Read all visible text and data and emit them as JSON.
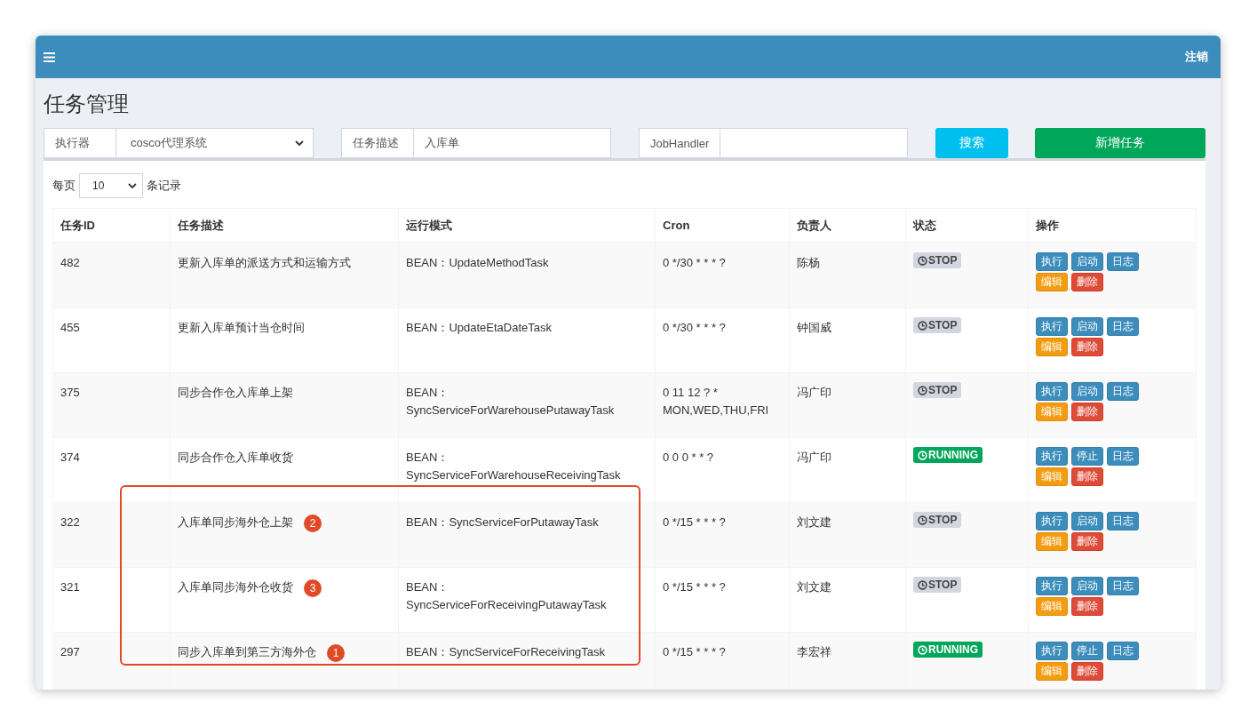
{
  "header": {
    "logout": "注销"
  },
  "page_title": "任务管理",
  "filters": {
    "executor": {
      "label": "执行器",
      "value": "cosco代理系统"
    },
    "description": {
      "label": "任务描述",
      "value": "入库单"
    },
    "handler": {
      "label": "JobHandler"
    },
    "search_button": "搜索",
    "add_button": "新增任务"
  },
  "page_size": {
    "prefix": "每页",
    "value": "10",
    "suffix": "条记录"
  },
  "table": {
    "columns": [
      "任务ID",
      "任务描述",
      "运行模式",
      "Cron",
      "负责人",
      "状态",
      "操作"
    ],
    "rows": [
      {
        "id": "482",
        "description": "更新入库单的派送方式和运输方式",
        "mode": "BEAN：UpdateMethodTask",
        "cron": "0 */30 * * * ?",
        "owner": "陈杨",
        "status": {
          "kind": "stop",
          "label": "STOP"
        },
        "actions": [
          {
            "label": "执行",
            "kind": "primary"
          },
          {
            "label": "启动",
            "kind": "primary"
          },
          {
            "label": "日志",
            "kind": "primary"
          },
          {
            "label": "编辑",
            "kind": "warning"
          },
          {
            "label": "删除",
            "kind": "danger"
          }
        ]
      },
      {
        "id": "455",
        "description": "更新入库单预计当仓时间",
        "mode": "BEAN：UpdateEtaDateTask",
        "cron": "0 */30 * * * ?",
        "owner": "钟国威",
        "status": {
          "kind": "stop",
          "label": "STOP"
        },
        "actions": [
          {
            "label": "执行",
            "kind": "primary"
          },
          {
            "label": "启动",
            "kind": "primary"
          },
          {
            "label": "日志",
            "kind": "primary"
          },
          {
            "label": "编辑",
            "kind": "warning"
          },
          {
            "label": "删除",
            "kind": "danger"
          }
        ]
      },
      {
        "id": "375",
        "description": "同步合作仓入库单上架",
        "mode": "BEAN：SyncServiceForWarehousePutawayTask",
        "cron": "0 11 12 ? * MON,WED,THU,FRI",
        "owner": "冯广印",
        "status": {
          "kind": "stop",
          "label": "STOP"
        },
        "actions": [
          {
            "label": "执行",
            "kind": "primary"
          },
          {
            "label": "启动",
            "kind": "primary"
          },
          {
            "label": "日志",
            "kind": "primary"
          },
          {
            "label": "编辑",
            "kind": "warning"
          },
          {
            "label": "删除",
            "kind": "danger"
          }
        ]
      },
      {
        "id": "374",
        "description": "同步合作仓入库单收货",
        "mode": "BEAN：SyncServiceForWarehouseReceivingTask",
        "cron": "0 0 0 * * ?",
        "owner": "冯广印",
        "status": {
          "kind": "running",
          "label": "RUNNING"
        },
        "actions": [
          {
            "label": "执行",
            "kind": "primary"
          },
          {
            "label": "停止",
            "kind": "primary"
          },
          {
            "label": "日志",
            "kind": "primary"
          },
          {
            "label": "编辑",
            "kind": "warning"
          },
          {
            "label": "删除",
            "kind": "danger"
          }
        ]
      },
      {
        "id": "322",
        "description": "入库单同步海外仓上架",
        "marker": "2",
        "mode": "BEAN：SyncServiceForPutawayTask",
        "cron": "0 */15 * * * ?",
        "owner": "刘文建",
        "status": {
          "kind": "stop",
          "label": "STOP"
        },
        "actions": [
          {
            "label": "执行",
            "kind": "primary"
          },
          {
            "label": "启动",
            "kind": "primary"
          },
          {
            "label": "日志",
            "kind": "primary"
          },
          {
            "label": "编辑",
            "kind": "warning"
          },
          {
            "label": "删除",
            "kind": "danger"
          }
        ]
      },
      {
        "id": "321",
        "description": "入库单同步海外仓收货",
        "marker": "3",
        "mode": "BEAN：SyncServiceForReceivingPutawayTask",
        "cron": "0 */15 * * * ?",
        "owner": "刘文建",
        "status": {
          "kind": "stop",
          "label": "STOP"
        },
        "actions": [
          {
            "label": "执行",
            "kind": "primary"
          },
          {
            "label": "启动",
            "kind": "primary"
          },
          {
            "label": "日志",
            "kind": "primary"
          },
          {
            "label": "编辑",
            "kind": "warning"
          },
          {
            "label": "删除",
            "kind": "danger"
          }
        ]
      },
      {
        "id": "297",
        "description": "同步入库单到第三方海外仓",
        "marker": "1",
        "mode": "BEAN：SyncServiceForReceivingTask",
        "cron": "0 */15 * * * ?",
        "owner": "李宏祥",
        "status": {
          "kind": "running",
          "label": "RUNNING"
        },
        "actions": [
          {
            "label": "执行",
            "kind": "primary"
          },
          {
            "label": "停止",
            "kind": "primary"
          },
          {
            "label": "日志",
            "kind": "primary"
          },
          {
            "label": "编辑",
            "kind": "warning"
          },
          {
            "label": "删除",
            "kind": "danger"
          }
        ]
      }
    ]
  }
}
